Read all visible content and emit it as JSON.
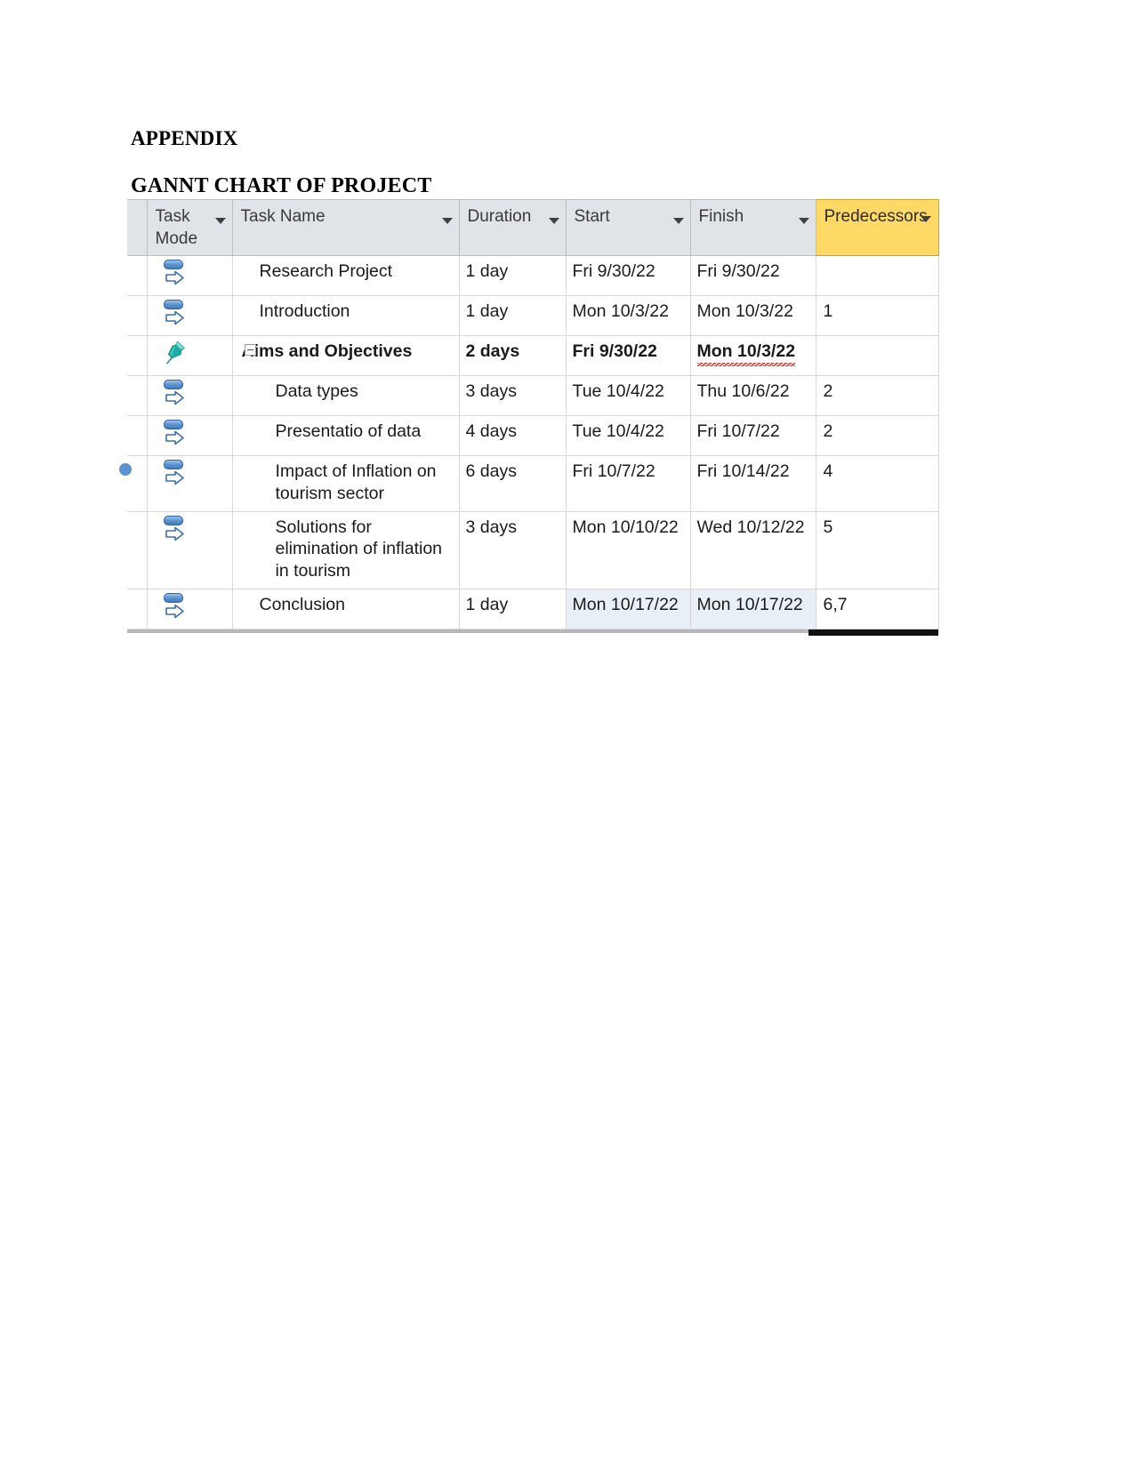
{
  "document": {
    "appendix_heading": "APPENDIX",
    "gantt_heading": "GANNT CHART OF PROJECT"
  },
  "colors": {
    "header_background": "#e0e3e8",
    "predecessors_header_background": "#ffd966",
    "selection_highlight": "#e8eff7",
    "auto_schedule_icon": "#5b93d0",
    "manual_schedule_pin": "#2ec4b6",
    "spellcheck_underline": "#e8271c",
    "grid_line": "#d5d7da"
  },
  "table": {
    "columns": [
      {
        "key": "indicator",
        "label": "",
        "has_filter": false,
        "highlighted": false
      },
      {
        "key": "task_mode",
        "label": "Task Mode",
        "has_filter": true,
        "highlighted": false
      },
      {
        "key": "task_name",
        "label": "Task Name",
        "has_filter": true,
        "highlighted": false
      },
      {
        "key": "duration",
        "label": "Duration",
        "has_filter": true,
        "highlighted": false
      },
      {
        "key": "start",
        "label": "Start",
        "has_filter": true,
        "highlighted": false
      },
      {
        "key": "finish",
        "label": "Finish",
        "has_filter": true,
        "highlighted": false
      },
      {
        "key": "predecessors",
        "label": "Predecessors",
        "has_filter": true,
        "highlighted": true
      }
    ],
    "rows": [
      {
        "task_mode_icon": "auto-scheduled-icon",
        "task_name": "Research Project",
        "duration": "1 day",
        "start": "Fri 9/30/22",
        "finish": "Fri 9/30/22",
        "predecessors": "",
        "indent": 1,
        "summary": false,
        "selected": false,
        "finish_spellchecked": false
      },
      {
        "task_mode_icon": "auto-scheduled-icon",
        "task_name": "Introduction",
        "duration": "1 day",
        "start": "Mon 10/3/22",
        "finish": "Mon 10/3/22",
        "predecessors": "1",
        "indent": 1,
        "summary": false,
        "selected": false,
        "finish_spellchecked": false
      },
      {
        "task_mode_icon": "manually-scheduled-pin-icon",
        "task_name": "Aims and Objectives",
        "duration": "2 days",
        "start": "Fri 9/30/22",
        "finish": "Mon 10/3/22",
        "predecessors": "",
        "indent": 0,
        "summary": true,
        "selected": false,
        "finish_spellchecked": true
      },
      {
        "task_mode_icon": "auto-scheduled-icon",
        "task_name": "Data types",
        "duration": "3 days",
        "start": "Tue 10/4/22",
        "finish": "Thu 10/6/22",
        "predecessors": "2",
        "indent": 2,
        "summary": false,
        "selected": false,
        "finish_spellchecked": false
      },
      {
        "task_mode_icon": "auto-scheduled-icon",
        "task_name": "Presentatio of data",
        "duration": "4 days",
        "start": "Tue 10/4/22",
        "finish": "Fri 10/7/22",
        "predecessors": "2",
        "indent": 2,
        "summary": false,
        "selected": false,
        "finish_spellchecked": false
      },
      {
        "task_mode_icon": "auto-scheduled-icon",
        "task_name": "Impact of Inflation on tourism sector",
        "duration": "6 days",
        "start": "Fri 10/7/22",
        "finish": "Fri 10/14/22",
        "predecessors": "4",
        "indent": 2,
        "summary": false,
        "selected": false,
        "finish_spellchecked": false
      },
      {
        "task_mode_icon": "auto-scheduled-icon",
        "task_name": "Solutions for elimination of inflation in tourism",
        "duration": "3 days",
        "start": "Mon 10/10/22",
        "finish": "Wed 10/12/22",
        "predecessors": "5",
        "indent": 2,
        "summary": false,
        "selected": false,
        "finish_spellchecked": false
      },
      {
        "task_mode_icon": "auto-scheduled-icon",
        "task_name": "Conclusion",
        "duration": "1 day",
        "start": "Mon 10/17/22",
        "finish": "Mon 10/17/22",
        "predecessors": "6,7",
        "indent": 1,
        "summary": false,
        "selected": true,
        "finish_spellchecked": false
      }
    ]
  }
}
